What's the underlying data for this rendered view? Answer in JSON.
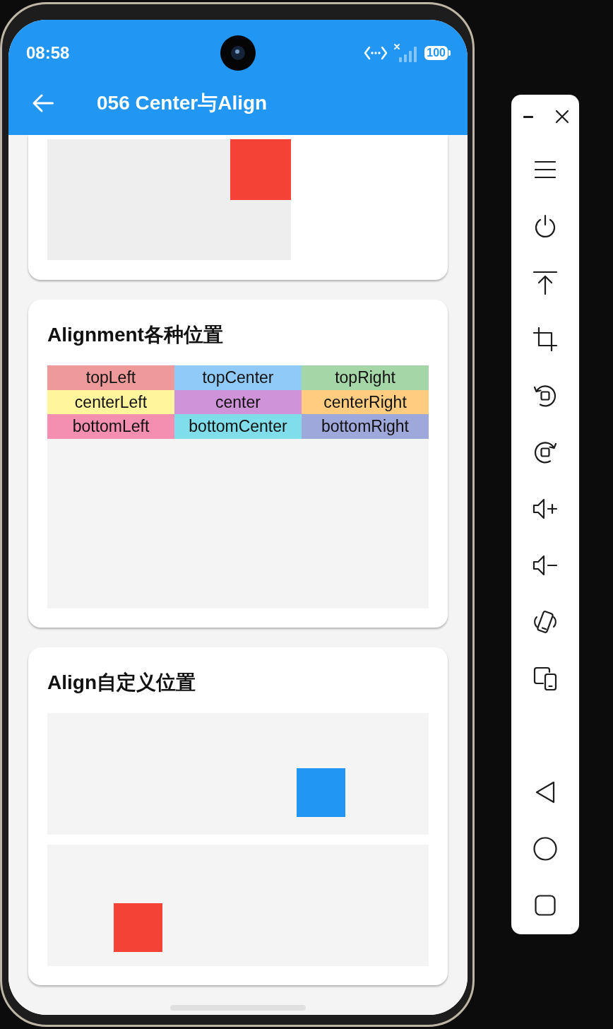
{
  "status_bar": {
    "time": "08:58",
    "battery": "100"
  },
  "app_bar": {
    "title": "056 Center与Align"
  },
  "cards": [
    {
      "kind": "single"
    },
    {
      "kind": "grid",
      "title": "Alignment各种位置",
      "cells": [
        {
          "label": "topLeft",
          "color": "#ef9a9a"
        },
        {
          "label": "topCenter",
          "color": "#90caf9"
        },
        {
          "label": "topRight",
          "color": "#a5d6a7"
        },
        {
          "label": "centerLeft",
          "color": "#fff59d"
        },
        {
          "label": "center",
          "color": "#ce93d8"
        },
        {
          "label": "centerRight",
          "color": "#ffcc80"
        },
        {
          "label": "bottomLeft",
          "color": "#f48fb1"
        },
        {
          "label": "bottomCenter",
          "color": "#80deea"
        },
        {
          "label": "bottomRight",
          "color": "#9fa8da"
        }
      ]
    },
    {
      "kind": "custom",
      "title": "Align自定义位置",
      "squares": [
        {
          "color": "#2196f3"
        },
        {
          "color": "#f44336"
        }
      ]
    }
  ]
}
